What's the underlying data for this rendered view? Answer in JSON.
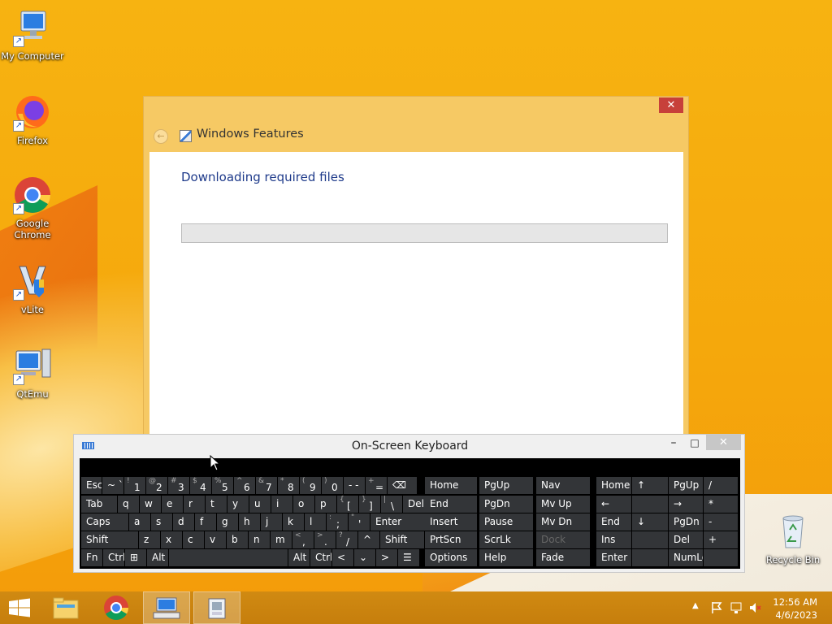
{
  "desktop": {
    "icons": [
      {
        "label": "My Computer",
        "icon": "computer-icon"
      },
      {
        "label": "Firefox",
        "icon": "firefox-icon"
      },
      {
        "label": "Google Chrome",
        "icon": "chrome-icon"
      },
      {
        "label": "vLite",
        "icon": "vlite-icon"
      },
      {
        "label": "QtEmu",
        "icon": "qtemu-icon"
      },
      {
        "label": "Recycle Bin",
        "icon": "recycle-bin-icon"
      }
    ]
  },
  "features_dialog": {
    "title": "Windows Features",
    "heading": "Downloading required files",
    "progress_percent": 0,
    "close_glyph": "✕",
    "back_glyph": "←"
  },
  "osk": {
    "title": "On-Screen Keyboard",
    "min_glyph": "–",
    "max_glyph": "□",
    "close_glyph": "✕",
    "rows": [
      [
        {
          "main": "Esc"
        },
        {
          "main": "~ `"
        },
        {
          "sub": "!",
          "main": "1"
        },
        {
          "sub": "@",
          "main": "2"
        },
        {
          "sub": "#",
          "main": "3"
        },
        {
          "sub": "$",
          "main": "4"
        },
        {
          "sub": "%",
          "main": "5"
        },
        {
          "sub": "^",
          "main": "6"
        },
        {
          "sub": "&",
          "main": "7"
        },
        {
          "sub": "*",
          "main": "8"
        },
        {
          "sub": "(",
          "main": "9"
        },
        {
          "sub": ")",
          "main": "0"
        },
        {
          "main": "- -"
        },
        {
          "sub": "+",
          "main": "="
        },
        {
          "main": "⌫"
        }
      ],
      [
        {
          "main": "Tab"
        },
        {
          "main": "q"
        },
        {
          "main": "w"
        },
        {
          "main": "e"
        },
        {
          "main": "r"
        },
        {
          "main": "t"
        },
        {
          "main": "y"
        },
        {
          "main": "u"
        },
        {
          "main": "i"
        },
        {
          "main": "o"
        },
        {
          "main": "p"
        },
        {
          "sub": "{",
          "main": "["
        },
        {
          "sub": "}",
          "main": "]"
        },
        {
          "sub": "|",
          "main": "\\"
        },
        {
          "main": "Del"
        }
      ],
      [
        {
          "main": "Caps"
        },
        {
          "main": "a"
        },
        {
          "main": "s"
        },
        {
          "main": "d"
        },
        {
          "main": "f"
        },
        {
          "main": "g"
        },
        {
          "main": "h"
        },
        {
          "main": "j"
        },
        {
          "main": "k"
        },
        {
          "main": "l"
        },
        {
          "sub": ":",
          "main": ";"
        },
        {
          "sub": "\"",
          "main": "'"
        },
        {
          "main": "Enter"
        }
      ],
      [
        {
          "main": "Shift"
        },
        {
          "main": "z"
        },
        {
          "main": "x"
        },
        {
          "main": "c"
        },
        {
          "main": "v"
        },
        {
          "main": "b"
        },
        {
          "main": "n"
        },
        {
          "main": "m"
        },
        {
          "sub": "<",
          "main": ","
        },
        {
          "sub": ">",
          "main": "."
        },
        {
          "sub": "?",
          "main": "/"
        },
        {
          "main": "^"
        },
        {
          "main": "Shift"
        }
      ],
      [
        {
          "main": "Fn"
        },
        {
          "main": "Ctrl"
        },
        {
          "main": "⊞"
        },
        {
          "main": "Alt"
        },
        {
          "main": ""
        },
        {
          "main": "Alt"
        },
        {
          "main": "Ctrl"
        },
        {
          "main": "<"
        },
        {
          "main": "⌄"
        },
        {
          "main": ">"
        },
        {
          "main": "☰"
        }
      ]
    ],
    "nav_keys": [
      [
        "Home",
        "PgUp",
        "Nav"
      ],
      [
        "End",
        "PgDn",
        "Mv Up"
      ],
      [
        "Insert",
        "Pause",
        "Mv Dn"
      ],
      [
        "PrtScn",
        "ScrLk",
        "Dock"
      ],
      [
        "Options",
        "Help",
        "Fade"
      ]
    ],
    "numpad_keys": [
      [
        "Home",
        "↑",
        "PgUp",
        "/"
      ],
      [
        "←",
        "",
        "→",
        "*"
      ],
      [
        "End",
        "↓",
        "PgDn",
        "-"
      ],
      [
        "Ins",
        "",
        "Del",
        "+"
      ],
      [
        "Enter",
        "",
        "NumLock",
        ""
      ]
    ],
    "disabled_keys": [
      "Dock"
    ]
  },
  "taskbar": {
    "start_icon": "windows-start-icon",
    "apps": [
      {
        "name": "file-explorer",
        "icon": "folder-icon",
        "active": false
      },
      {
        "name": "chrome",
        "icon": "chrome-icon",
        "active": false
      },
      {
        "name": "on-screen-keyboard",
        "icon": "keyboard-app-icon",
        "active": true
      },
      {
        "name": "windows-features",
        "icon": "features-app-icon",
        "active": true
      }
    ],
    "clock_time": "12:56 AM",
    "clock_date": "4/6/2023",
    "tray_icons": [
      "show-hidden-icons-icon",
      "action-center-flag-icon",
      "network-icon",
      "volume-muted-icon"
    ],
    "colors": {
      "taskbar": "#c67e0c"
    }
  }
}
